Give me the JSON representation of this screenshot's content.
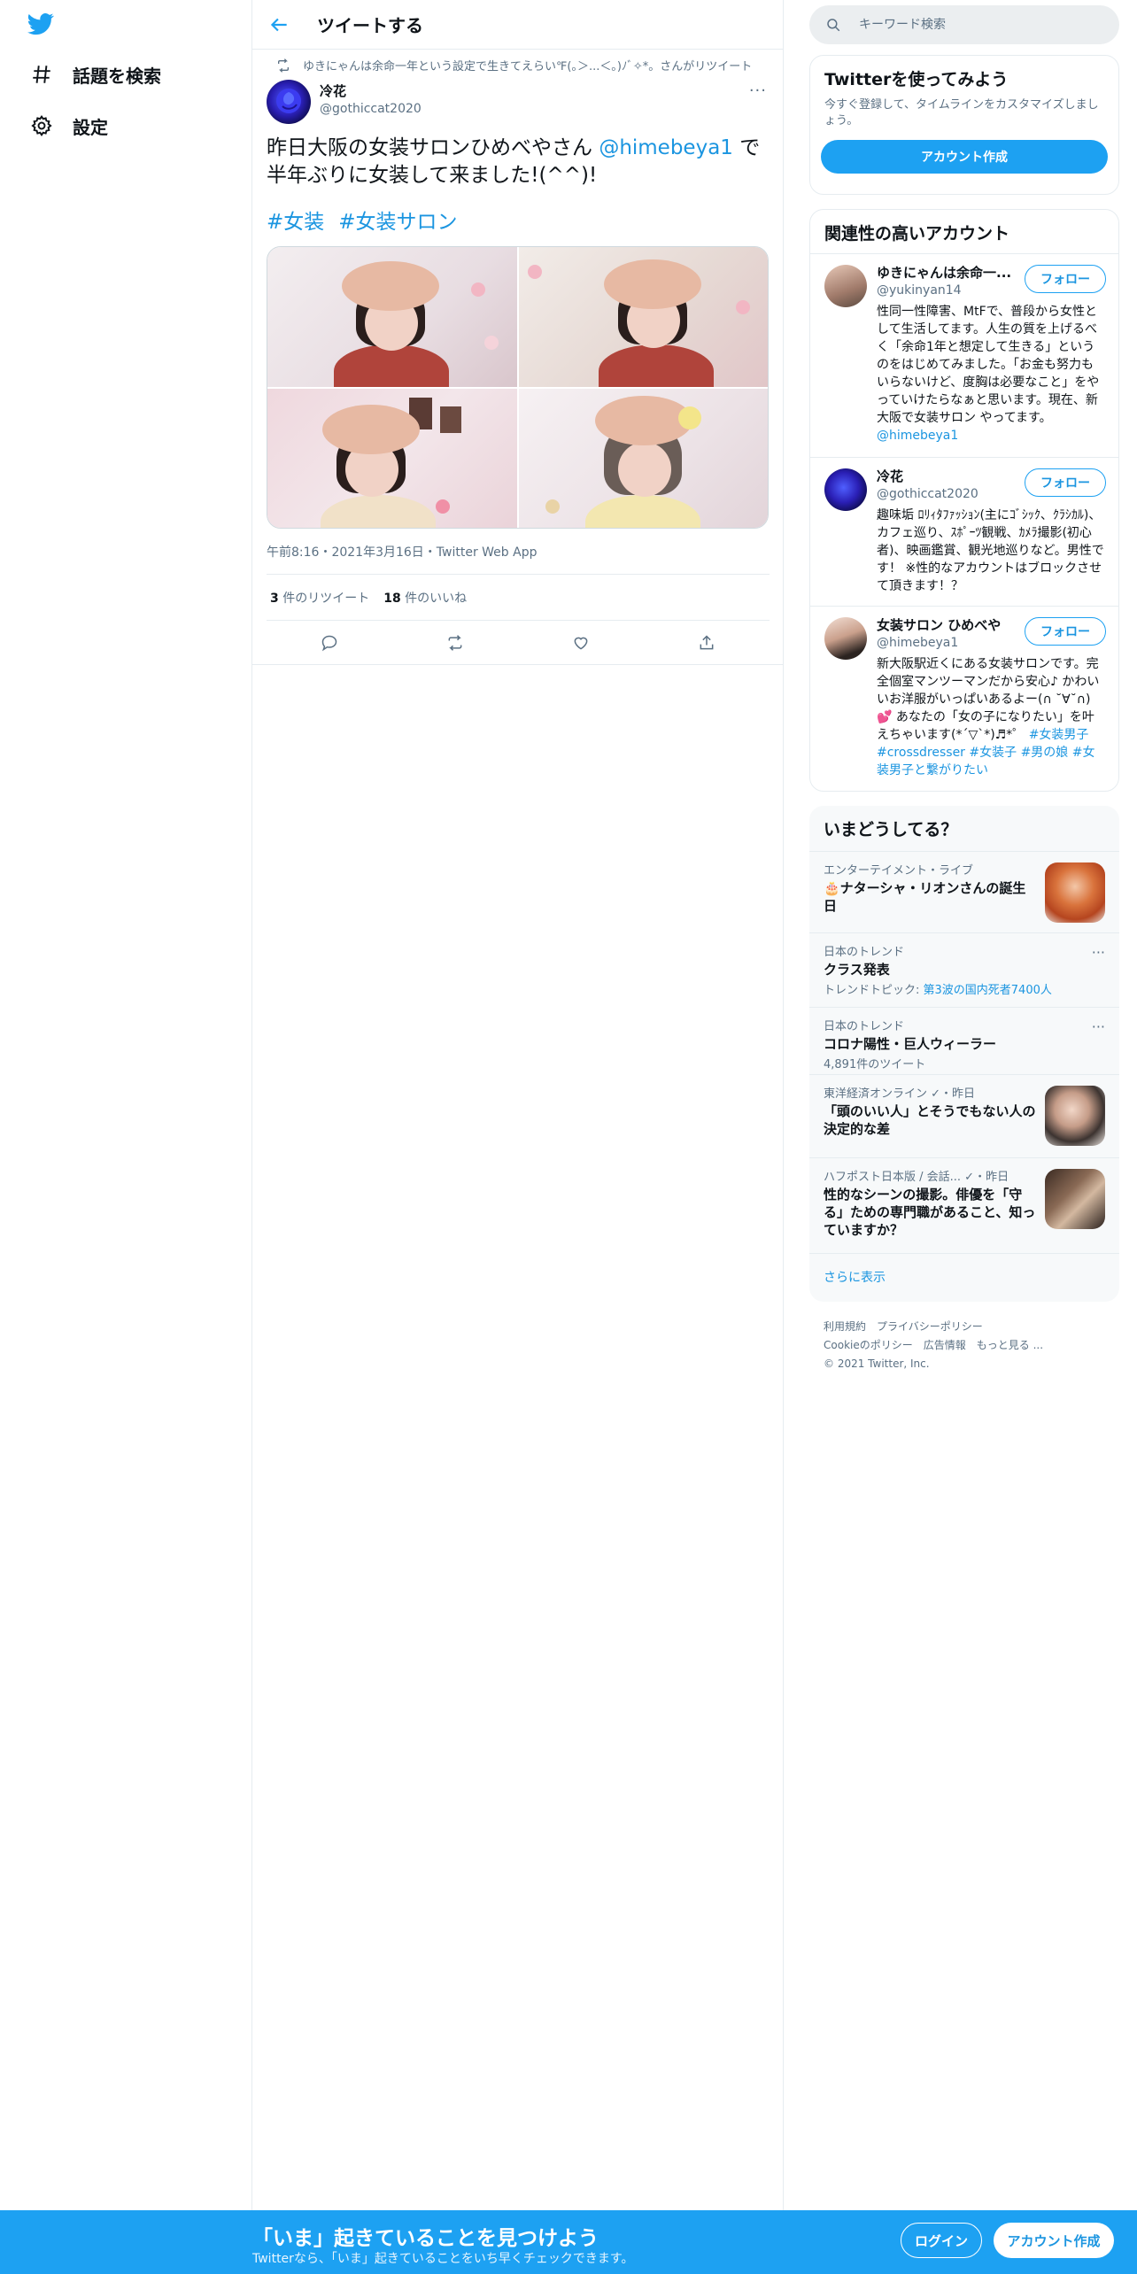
{
  "colors": {
    "accent": "#1da1f2",
    "link": "#1b95e0",
    "text": "#0f1419",
    "muted": "#5b7083",
    "border": "#e6ecf0"
  },
  "nav": {
    "logo_icon": "twitter-bird-icon",
    "items": [
      {
        "icon": "hashtag-icon",
        "label": "話題を検索"
      },
      {
        "icon": "gear-icon",
        "label": "設定"
      }
    ]
  },
  "main": {
    "header_title": "ツイートする",
    "retweet_note": "ゆきにゃんは余命一年という設定で生きてえらい℉(｡＞...＜｡)ﾉﾞ✧*。さんがリツイート",
    "author": {
      "name": "冷花",
      "handle": "@gothiccat2020"
    },
    "more_label": "···",
    "tweet_text_pre": "昨日大阪の女装サロンひめべやさん ",
    "tweet_mention": "@himebeya1",
    "tweet_text_post": " で半年ぶりに女装して来ました!(^^)!",
    "hashtags": [
      "#女装",
      "#女装サロン"
    ],
    "meta": "午前8:16・2021年3月16日・Twitter Web App",
    "retweets": {
      "count": "3",
      "label": "件のリツイート"
    },
    "likes": {
      "count": "18",
      "label": "件のいいね"
    }
  },
  "right": {
    "search_placeholder": "キーワード検索",
    "signup_card": {
      "title": "Twitterを使ってみよう",
      "subtitle": "今すぐ登録して、タイムラインをカスタマイズしましょう。",
      "button": "アカウント作成"
    },
    "related": {
      "title": "関連性の高いアカウント",
      "follow_label": "フォロー",
      "accounts": [
        {
          "name": "ゆきにゃんは余命一...",
          "handle": "@yukinyan14",
          "bio": "性同一性障害、MtFで、普段から女性として生活してます。人生の質を上げるべく「余命1年と想定して生きる」というのをはじめてみました。「お金も努力もいらないけど、度胸は必要なこと」をやっていけたらなぁと思います。現在、新大阪で女装サロン やってます。",
          "bio_link": "@himebeya1"
        },
        {
          "name": "冷花",
          "handle": "@gothiccat2020",
          "bio": "趣味垢 ﾛﾘｨﾀﾌｧｯｼｮﾝ(主にｺﾞｼｯｸ、ｸﾗｼｶﾙ)、カフェ巡り、ｽﾎﾟｰﾂ観戦、ｶﾒﾗ撮影(初心者)、映画鑑賞、観光地巡りなど。男性です！ ※性的なアカウントはブロックさせて頂きます！？"
        },
        {
          "name": "女装サロン ひめべや",
          "handle": "@himebeya1",
          "bio": "新大阪駅近くにある女装サロンです。完全個室マンツーマンだから安心♪ かわいいお洋服がいっぱいあるよー(∩ ˘∀˘∩)💕 あなたの「女の子になりたい」を叶えちゃいます(*´▽`*)♬*゜",
          "bio_tags": "#女装男子 #crossdresser #女装子 #男の娘 #女装男子と繋がりたい"
        }
      ]
    },
    "trends": {
      "title": "いまどうしてる？",
      "items": [
        {
          "category": "エンターテイメント・ライブ",
          "title": "🎂ナターシャ・リオンさんの誕生日",
          "thumb": "portrait-thumbnail"
        },
        {
          "category": "日本のトレンド",
          "title": "クラス発表",
          "sub_prefix": "トレンドトピック: ",
          "sub_link": "第3波の国内死者7400人"
        },
        {
          "category": "日本のトレンド",
          "title": "コロナ陽性・巨人ウィーラー",
          "sub": "4,891件のツイート"
        },
        {
          "category": "東洋経済オンライン ✓・昨日",
          "title": "「頭のいい人」とそうでもない人の決定的な差",
          "thumb": "news-thumbnail"
        },
        {
          "category": "ハフポスト日本版 / 会話... ✓・昨日",
          "title": "性的なシーンの撮影。俳優を「守る」ための専門職があること、知っていますか？",
          "thumb": "news-thumbnail"
        }
      ],
      "show_more": "さらに表示"
    },
    "footer": {
      "links": [
        "利用規約",
        "プライバシーポリシー",
        "Cookieのポリシー",
        "広告情報",
        "もっと見る ..."
      ],
      "copyright": "© 2021 Twitter, Inc."
    }
  },
  "bottom_bar": {
    "title": "「いま」起きていることを見つけよう",
    "subtitle": "Twitterなら、「いま」起きていることをいち早くチェックできます。",
    "login": "ログイン",
    "signup": "アカウント作成"
  }
}
